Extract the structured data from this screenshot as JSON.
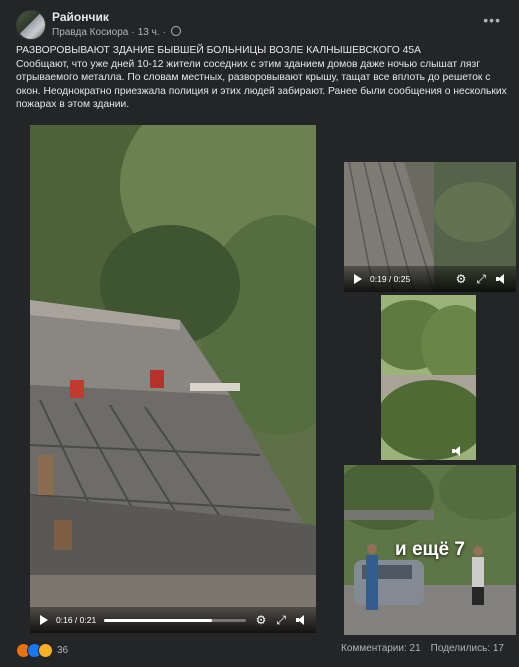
{
  "header": {
    "page_name": "Райончик",
    "source": "Правда Косиора",
    "time": "13 ч.",
    "more_icon": "more-horizontal-icon"
  },
  "post": {
    "title": "РАЗВОРОВЫВАЮТ ЗДАНИЕ БЫВШЕЙ БОЛЬНИЦЫ ВОЗЛЕ КАЛНЫШЕВСКОГО 45А",
    "body": "Сообщают, что уже дней 10-12 жители соседних с этим зданием домов даже ночью слышат лязг отрываемого металла. По словам местных, разворовывают крышу, тащат все вплоть до решеток с окон. Неоднократно приезжала полиция и этих людей забирают.  Ранее были сообщения о нескольких пожарах в этом здании."
  },
  "media": {
    "main_video": {
      "time": "0:16 / 0:21",
      "progress": 0.76
    },
    "right_video": {
      "time": "0:19 / 0:25",
      "progress": 0.76
    },
    "more_label": "и ещё 7"
  },
  "footer": {
    "reaction_count": "36",
    "comments": "Комментарии: 21",
    "shares": "Поделились: 17"
  },
  "icons": {
    "play": "play-icon",
    "settings": "gear-icon",
    "fullscreen": "fullscreen-icon",
    "volume": "volume-icon"
  },
  "colors": {
    "background": "#242526",
    "text": "#e4e6eb",
    "secondary_text": "#b0b3b8",
    "like": "#1877f2",
    "angry": "#e9710f",
    "sad": "#f7b125"
  }
}
